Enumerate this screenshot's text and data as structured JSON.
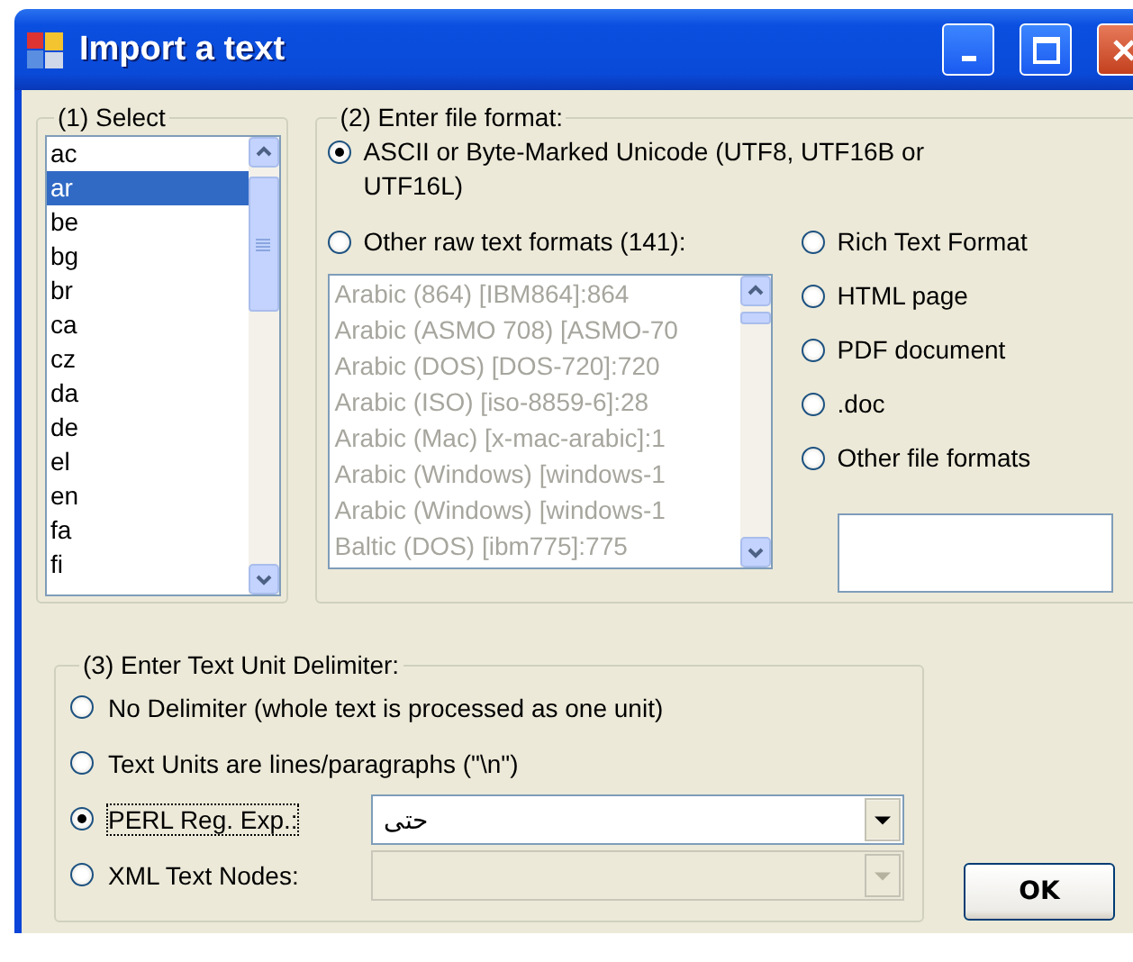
{
  "window": {
    "title": "Import a text"
  },
  "select_group": {
    "label": "(1) Select",
    "items": [
      {
        "text": "ac",
        "selected": false
      },
      {
        "text": "ar",
        "selected": true
      },
      {
        "text": "be",
        "selected": false
      },
      {
        "text": "bg",
        "selected": false
      },
      {
        "text": "br",
        "selected": false
      },
      {
        "text": "ca",
        "selected": false
      },
      {
        "text": "cz",
        "selected": false
      },
      {
        "text": "da",
        "selected": false
      },
      {
        "text": "de",
        "selected": false
      },
      {
        "text": "el",
        "selected": false
      },
      {
        "text": "en",
        "selected": false
      },
      {
        "text": "fa",
        "selected": false
      },
      {
        "text": "fi",
        "selected": false
      }
    ]
  },
  "format_group": {
    "label": "(2) Enter file format:",
    "main_options": [
      {
        "label": "ASCII or Byte-Marked Unicode (UTF8, UTF16B or UTF16L)",
        "selected": true
      },
      {
        "label": "Other raw text formats (141):",
        "selected": false
      }
    ],
    "encodings": {
      "disabled": true,
      "items": [
        "Arabic (864) [IBM864]:864",
        "Arabic (ASMO 708) [ASMO-70",
        "Arabic (DOS) [DOS-720]:720",
        "Arabic (ISO) [iso-8859-6]:28",
        "Arabic (Mac) [x-mac-arabic]:1",
        "Arabic (Windows) [windows-1",
        "Arabic (Windows) [windows-1",
        "Baltic (DOS) [ibm775]:775"
      ]
    },
    "file_options": [
      {
        "label": "Rich Text Format",
        "selected": false
      },
      {
        "label": "HTML page",
        "selected": false
      },
      {
        "label": "PDF document",
        "selected": false
      },
      {
        "label": ".doc",
        "selected": false
      },
      {
        "label": "Other file formats",
        "selected": false
      }
    ]
  },
  "delimiter_group": {
    "label": "(3) Enter Text Unit Delimiter:",
    "options": [
      {
        "kind": "plain",
        "label": "No Delimiter (whole text is processed as one unit)",
        "selected": false,
        "focused": false
      },
      {
        "kind": "plain",
        "label": "Text Units are lines/paragraphs (\"\\n\")",
        "selected": false,
        "focused": false
      },
      {
        "kind": "combo",
        "label": "PERL Reg. Exp.:",
        "selected": true,
        "focused": true,
        "value": "حتى",
        "disabled": false
      },
      {
        "kind": "combo",
        "label": "XML Text Nodes:",
        "selected": false,
        "focused": false,
        "disabled": true
      }
    ]
  },
  "ok_button": "OK"
}
